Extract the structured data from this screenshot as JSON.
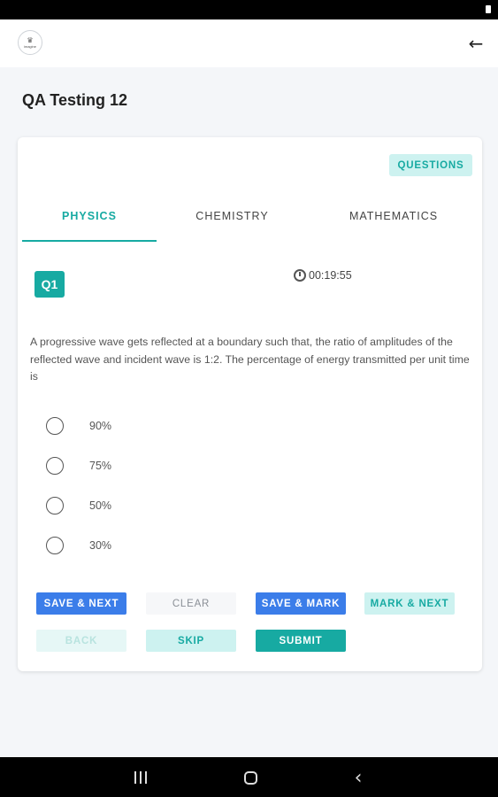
{
  "header": {
    "logo_icon": "crown-logo-icon",
    "logo_text": "imagine",
    "back_icon": "arrow-left-icon",
    "back_glyph": "←"
  },
  "page": {
    "title": "QA Testing 12"
  },
  "card": {
    "questions_label": "QUESTIONS",
    "tabs": [
      {
        "label": "PHYSICS",
        "active": true
      },
      {
        "label": "CHEMISTRY",
        "active": false
      },
      {
        "label": "MATHEMATICS",
        "active": false
      }
    ],
    "question_number": "Q1",
    "timer": "00:19:55",
    "timer_icon": "clock-icon",
    "question_text": "A progressive wave gets reflected at a boundary such that, the ratio of amplitudes of the reflected wave and incident wave is 1:2. The percentage of energy transmitted per unit time is",
    "options": [
      {
        "label": "90%",
        "selected": false
      },
      {
        "label": "75%",
        "selected": false
      },
      {
        "label": "50%",
        "selected": false
      },
      {
        "label": "30%",
        "selected": false
      }
    ],
    "buttons": {
      "save_next": "SAVE & NEXT",
      "clear": "CLEAR",
      "save_mark": "SAVE & MARK",
      "mark_next": "MARK & NEXT",
      "back": "BACK",
      "skip": "SKIP",
      "submit": "SUBMIT"
    }
  },
  "colors": {
    "accent_teal": "#17aaa2",
    "accent_teal_light": "#cdf2f0",
    "primary_blue": "#3b7de9",
    "background": "#f4f6f9"
  },
  "system_nav": {
    "recents_icon": "recents-icon",
    "home_icon": "home-icon",
    "back_icon": "back-chevron-icon",
    "back_glyph": "‹"
  }
}
